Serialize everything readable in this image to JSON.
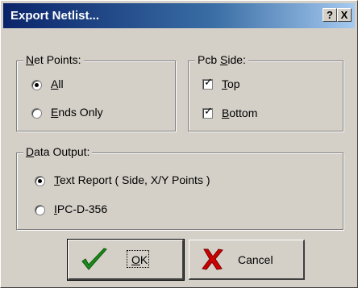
{
  "window": {
    "title": "Export Netlist...",
    "help_label": "?",
    "close_label": "X"
  },
  "net_points": {
    "legend_u": "N",
    "legend_rest": "et Points:",
    "options": [
      {
        "u": "A",
        "rest": "ll",
        "selected": true
      },
      {
        "u": "E",
        "rest": "nds Only",
        "selected": false
      }
    ]
  },
  "pcb_side": {
    "legend_pre": "Pcb ",
    "legend_u": "S",
    "legend_rest": "ide:",
    "options": [
      {
        "u": "T",
        "rest": "op",
        "checked": true
      },
      {
        "u": "B",
        "rest": "ottom",
        "checked": true
      }
    ]
  },
  "data_output": {
    "legend_u": "D",
    "legend_rest": "ata Output:",
    "options": [
      {
        "u": "T",
        "rest": "ext Report ( Side, X/Y Points )",
        "selected": true
      },
      {
        "u": "I",
        "rest": "PC-D-356",
        "selected": false
      }
    ]
  },
  "buttons": {
    "ok_u": "O",
    "ok_rest": "K",
    "cancel_label": "Cancel",
    "ok_icon": "green-checkmark-icon",
    "cancel_icon": "red-x-icon"
  },
  "colors": {
    "face": "#d4d0c8",
    "title_start": "#0a246a",
    "title_end": "#a6caf0",
    "ok_green": "#1a8a1a",
    "cancel_red": "#cc0000"
  }
}
